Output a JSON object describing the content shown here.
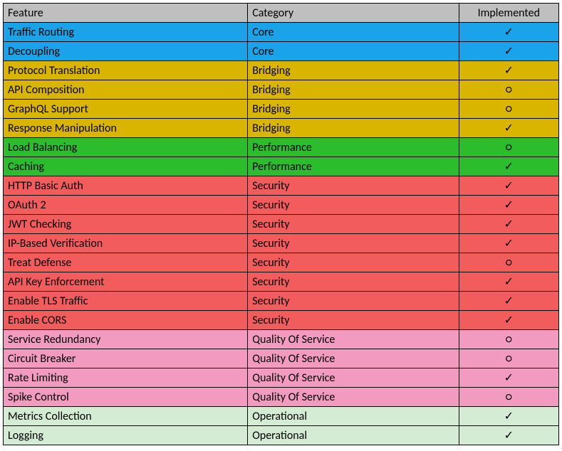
{
  "headers": {
    "feature": "Feature",
    "category": "Category",
    "implemented": "Implemented"
  },
  "symbols": {
    "yes": "✓",
    "no": "○"
  },
  "rows": [
    {
      "feature": "Traffic Routing",
      "category": "Core",
      "implemented": "yes",
      "class": "core"
    },
    {
      "feature": "Decoupling",
      "category": "Core",
      "implemented": "yes",
      "class": "core"
    },
    {
      "feature": "Protocol Translation",
      "category": "Bridging",
      "implemented": "yes",
      "class": "bridging"
    },
    {
      "feature": "API Composition",
      "category": "Bridging",
      "implemented": "no",
      "class": "bridging"
    },
    {
      "feature": "GraphQL Support",
      "category": "Bridging",
      "implemented": "no",
      "class": "bridging"
    },
    {
      "feature": "Response Manipulation",
      "category": "Bridging",
      "implemented": "yes",
      "class": "bridging"
    },
    {
      "feature": "Load Balancing",
      "category": "Performance",
      "implemented": "no",
      "class": "performance"
    },
    {
      "feature": "Caching",
      "category": "Performance",
      "implemented": "yes",
      "class": "performance"
    },
    {
      "feature": "HTTP Basic Auth",
      "category": "Security",
      "implemented": "yes",
      "class": "security"
    },
    {
      "feature": "OAuth 2",
      "category": "Security",
      "implemented": "yes",
      "class": "security"
    },
    {
      "feature": "JWT Checking",
      "category": "Security",
      "implemented": "yes",
      "class": "security"
    },
    {
      "feature": "IP-Based Verification",
      "category": "Security",
      "implemented": "yes",
      "class": "security"
    },
    {
      "feature": "Treat Defense",
      "category": "Security",
      "implemented": "no",
      "class": "security"
    },
    {
      "feature": "API Key Enforcement",
      "category": "Security",
      "implemented": "yes",
      "class": "security"
    },
    {
      "feature": "Enable TLS Traffic",
      "category": "Security",
      "implemented": "yes",
      "class": "security"
    },
    {
      "feature": "Enable CORS",
      "category": "Security",
      "implemented": "yes",
      "class": "security"
    },
    {
      "feature": "Service Redundancy",
      "category": "Quality Of Service",
      "implemented": "no",
      "class": "qos"
    },
    {
      "feature": "Circuit Breaker",
      "category": "Quality Of Service",
      "implemented": "no",
      "class": "qos"
    },
    {
      "feature": "Rate Limiting",
      "category": "Quality Of Service",
      "implemented": "yes",
      "class": "qos"
    },
    {
      "feature": "Spike Control",
      "category": "Quality Of Service",
      "implemented": "no",
      "class": "qos"
    },
    {
      "feature": "Metrics Collection",
      "category": "Operational",
      "implemented": "yes",
      "class": "operational"
    },
    {
      "feature": "Logging",
      "category": "Operational",
      "implemented": "yes",
      "class": "operational"
    }
  ]
}
